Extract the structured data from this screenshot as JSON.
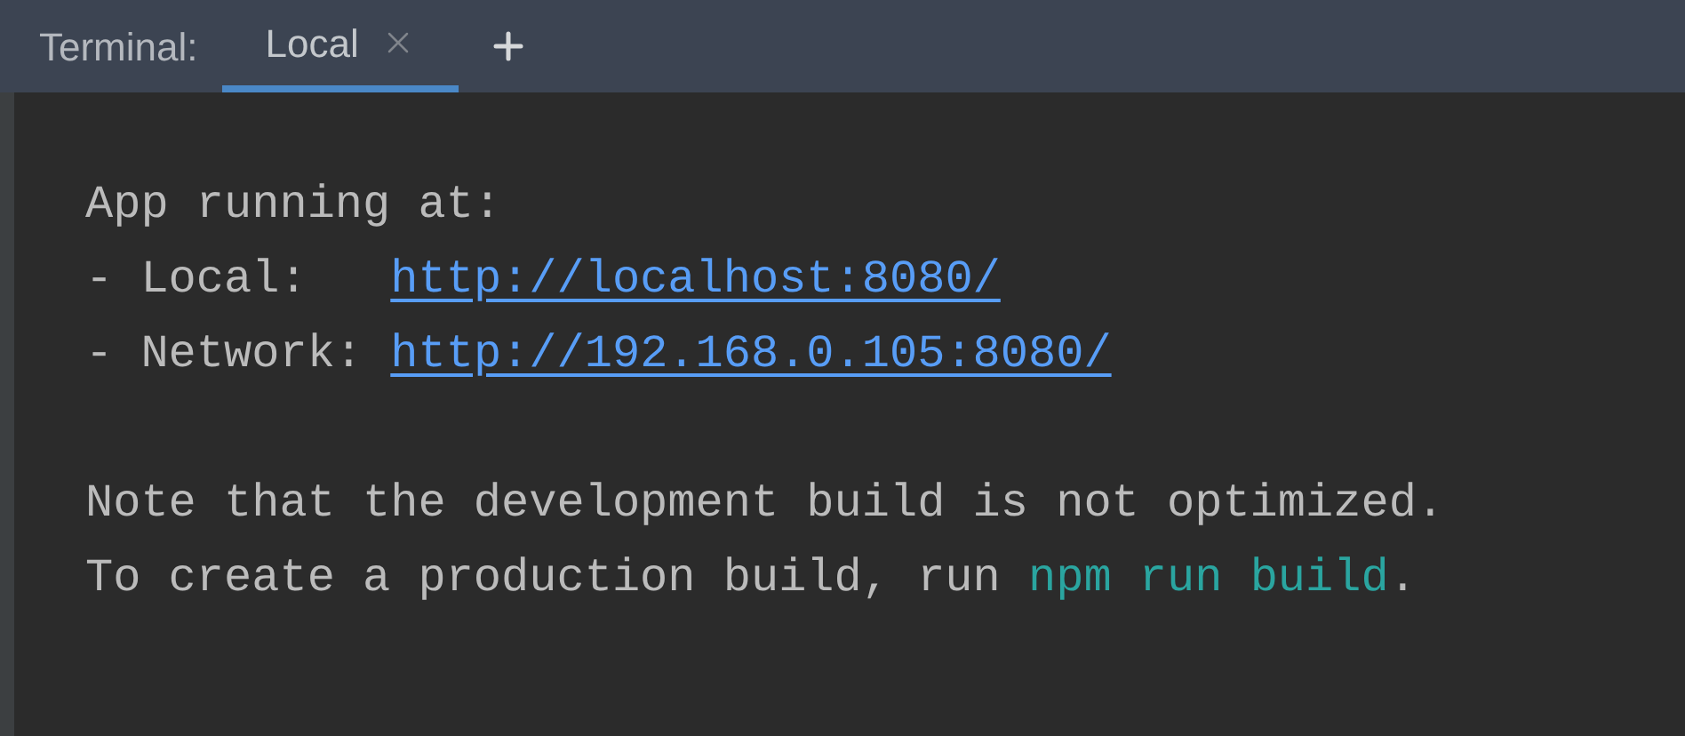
{
  "header": {
    "title": "Terminal:",
    "tabs": [
      {
        "label": "Local",
        "selected": true
      }
    ]
  },
  "output": {
    "paragraphs": [
      [
        [
          {
            "kind": "plain",
            "text": "App running at:"
          }
        ],
        [
          {
            "kind": "plain",
            "text": "- Local:   "
          },
          {
            "kind": "link",
            "text": "http://localhost:8080/"
          }
        ],
        [
          {
            "kind": "plain",
            "text": "- Network: "
          },
          {
            "kind": "link",
            "text": "http://192.168.0.105:8080/"
          }
        ]
      ],
      [
        [
          {
            "kind": "plain",
            "text": "Note that the development build is not optimized."
          }
        ],
        [
          {
            "kind": "plain",
            "text": "To create a production build, run "
          },
          {
            "kind": "command",
            "text": "npm run build"
          },
          {
            "kind": "plain",
            "text": "."
          }
        ]
      ]
    ]
  }
}
